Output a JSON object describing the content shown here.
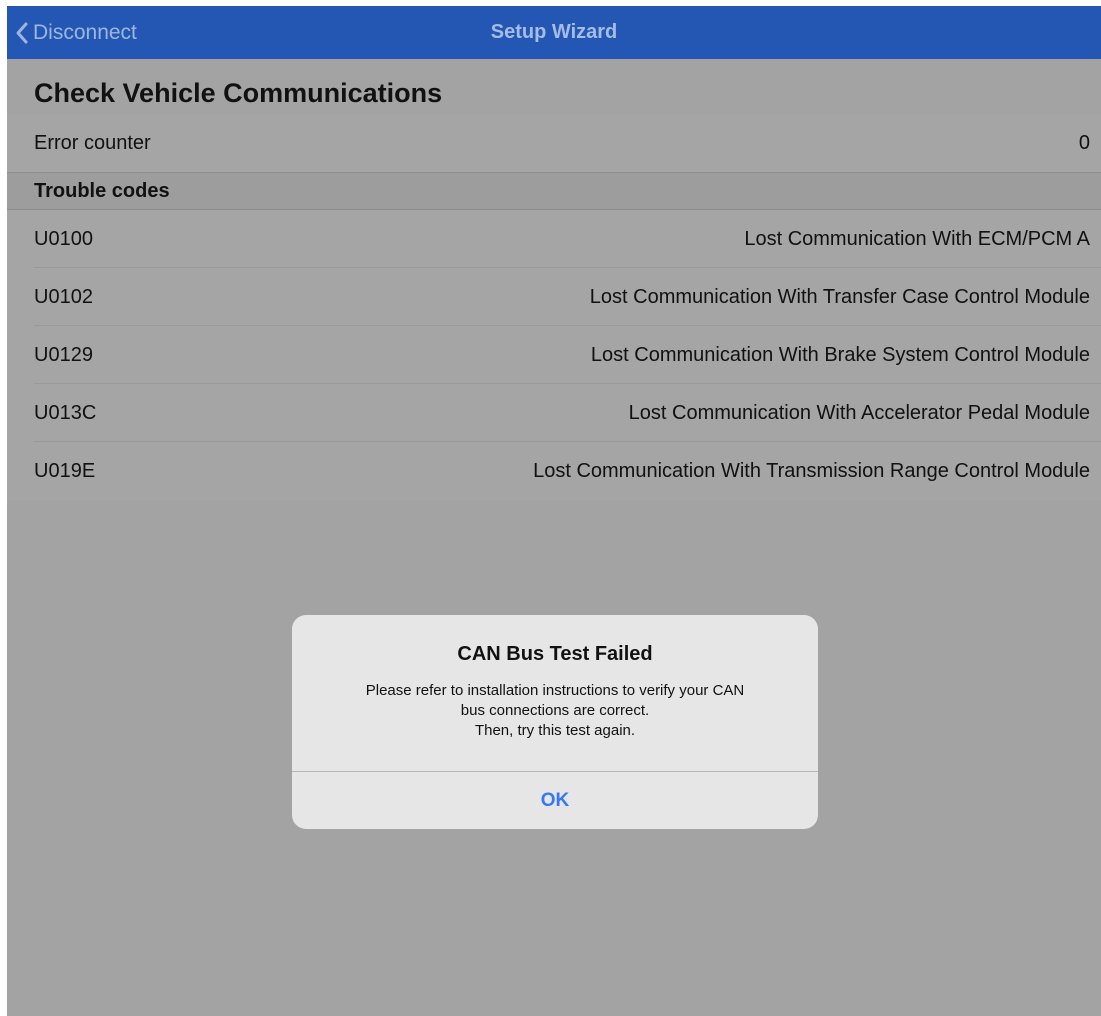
{
  "nav": {
    "back_label": "Disconnect",
    "title": "Setup Wizard"
  },
  "section": {
    "title": "Check Vehicle Communications"
  },
  "error_counter": {
    "label": "Error counter",
    "value": "0"
  },
  "trouble_codes": {
    "header": "Trouble codes",
    "items": [
      {
        "code": "U0100",
        "description": "Lost Communication With ECM/PCM A"
      },
      {
        "code": "U0102",
        "description": "Lost Communication With Transfer Case Control Module"
      },
      {
        "code": "U0129",
        "description": "Lost Communication With Brake System Control Module"
      },
      {
        "code": "U013C",
        "description": "Lost Communication With Accelerator Pedal Module"
      },
      {
        "code": "U019E",
        "description": "Lost Communication With Transmission Range Control Module"
      }
    ]
  },
  "alert": {
    "title": "CAN Bus Test Failed",
    "message_lines": [
      "Please refer to installation instructions to verify your CAN",
      "bus connections are correct.",
      "Then, try this test again."
    ],
    "button_label": "OK"
  },
  "colors": {
    "nav_bar": "#2457b3",
    "background_dimmed": "#a3a3a3",
    "alert_background": "#e6e6e6",
    "alert_button": "#3478f6"
  },
  "icons": {
    "back": "chevron-left-icon"
  }
}
